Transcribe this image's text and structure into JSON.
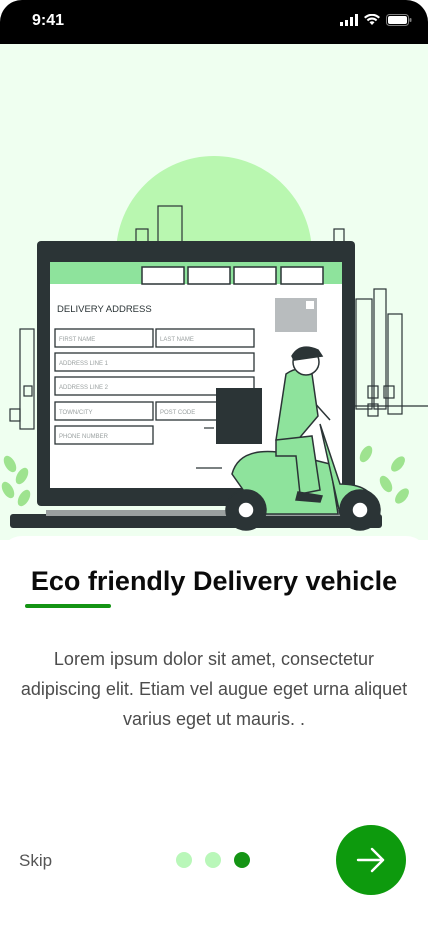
{
  "status_bar": {
    "time": "9:41"
  },
  "illustration": {
    "form_title": "DELIVERY ADDRESS",
    "fields": {
      "first_name": "FIRST NAME",
      "last_name": "LAST NAME",
      "address_line_1": "ADDRESS LINE 1",
      "address_line_2": "ADDRESS LINE 2",
      "town_city": "TOWN/CITY",
      "post_code": "POST CODE",
      "phone_number": "PHONE NUMBER"
    }
  },
  "onboarding": {
    "title": "Eco friendly Delivery vehicle",
    "description": "Lorem ipsum dolor sit amet, consectetur adipiscing elit. Etiam vel augue eget urna aliquet varius eget ut mauris. .",
    "skip_label": "Skip",
    "page_count": 3,
    "current_page": 3
  },
  "colors": {
    "accent": "#149414",
    "hero_bg": "#effff0",
    "light_green": "#b9f7b9"
  }
}
